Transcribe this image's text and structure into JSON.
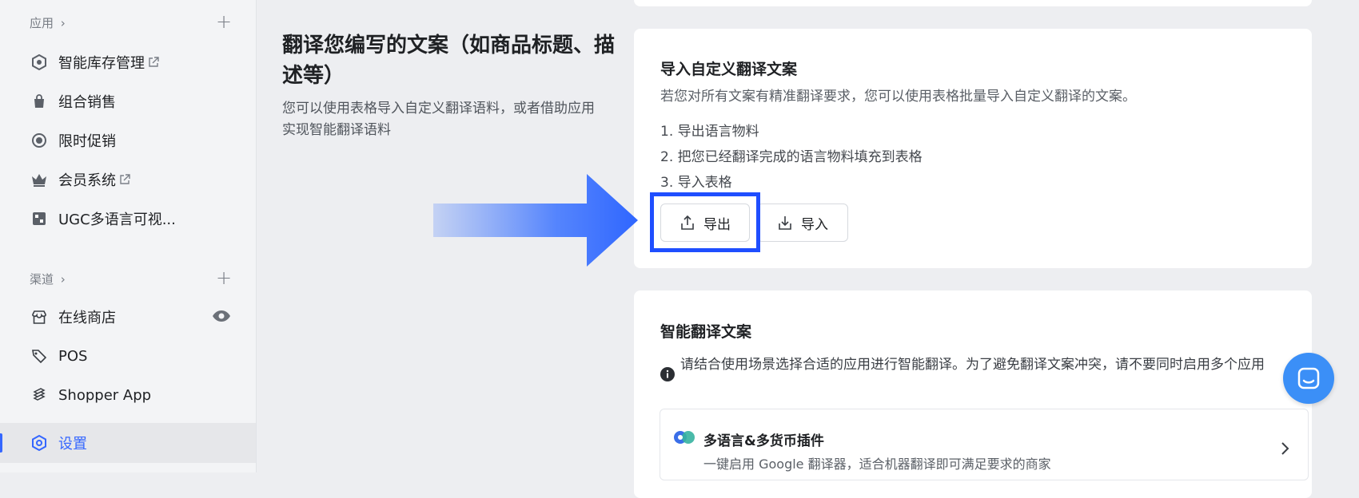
{
  "sidebar": {
    "apps_header": "应用",
    "channels_header": "渠道",
    "apps": [
      {
        "label": "智能库存管理",
        "icon": "hexagon-app-icon",
        "external": true
      },
      {
        "label": "组合销售",
        "icon": "shopping-bag-icon",
        "external": false
      },
      {
        "label": "限时促销",
        "icon": "clock-coin-icon",
        "external": false
      },
      {
        "label": "会员系统",
        "icon": "crown-icon",
        "external": true
      },
      {
        "label": "UGC多语言可视...",
        "icon": "ugc-app-icon",
        "external": false
      }
    ],
    "channels": [
      {
        "label": "在线商店",
        "icon": "storefront-icon"
      },
      {
        "label": "POS",
        "icon": "tag-icon"
      },
      {
        "label": "Shopper App",
        "icon": "layers-icon"
      }
    ],
    "settings_label": "设置"
  },
  "main": {
    "title": "翻译您编写的文案（如商品标题、描述等）",
    "description": "您可以使用表格导入自定义翻译语料，或者借助应用实现智能翻译语料"
  },
  "import_card": {
    "title": "导入自定义翻译文案",
    "subtitle": "若您对所有文案有精准翻译要求，您可以使用表格批量导入自定义翻译的文案。",
    "steps": [
      "1. 导出语言物料",
      "2. 把您已经翻译完成的语言物料填充到表格",
      "3. 导入表格"
    ],
    "export_label": "导出",
    "import_label": "导入"
  },
  "smart_card": {
    "title": "智能翻译文案",
    "notice": "请结合使用场景选择合适的应用进行智能翻译。为了避免翻译文案冲突，请不要同时启用多个应用",
    "plugin_name": "多语言&多货币插件",
    "plugin_desc": "一键启用 Google 翻译器，适合机器翻译即可满足要求的商家"
  },
  "colors": {
    "accent": "#3567ff",
    "highlight_border": "#1f4eff",
    "chat_button": "#3b8ff7"
  }
}
